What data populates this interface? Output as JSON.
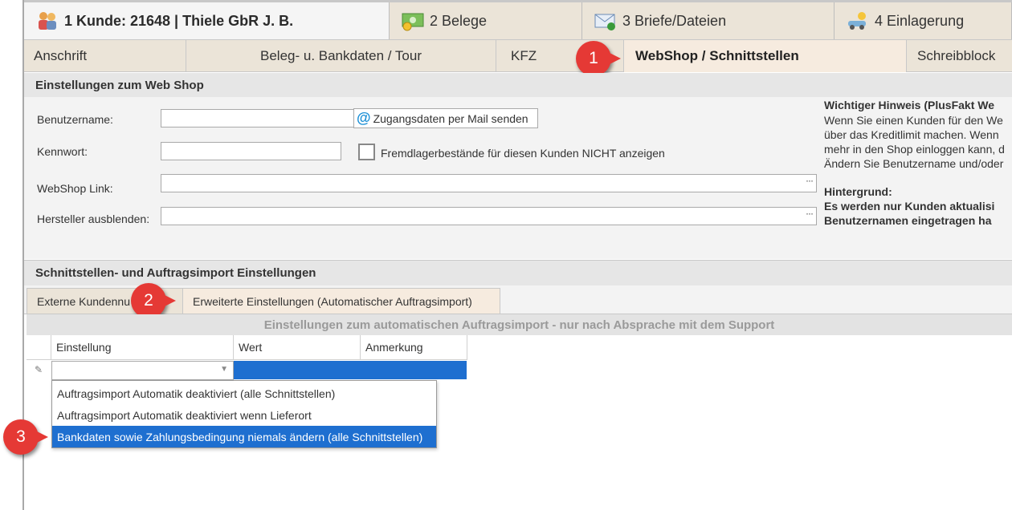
{
  "top_tabs": {
    "customer": "1 Kunde: 21648 | Thiele GbR J. B.",
    "belege": "2 Belege",
    "briefe": "3 Briefe/Dateien",
    "einlagerung": "4 Einlagerung"
  },
  "sub_tabs": {
    "anschrift": "Anschrift",
    "beleg": "Beleg- u. Bankdaten / Tour",
    "kfz": "KFZ",
    "webshop": "WebShop / Schnittstellen",
    "schreibblock": "Schreibblock"
  },
  "badges": [
    "1",
    "2",
    "3"
  ],
  "webshop_section": {
    "title": "Einstellungen zum Web Shop",
    "username_label": "Benutzername:",
    "username_value": "",
    "mail_button": "Zugangsdaten per Mail senden",
    "password_label": "Kennwort:",
    "password_value": "",
    "checkbox_label": "Fremdlagerbestände für diesen Kunden NICHT anzeigen",
    "link_label": "WebShop Link:",
    "link_value": "",
    "manufacturer_label": "Hersteller ausblenden:",
    "manufacturer_value": "",
    "ellipsis": "···"
  },
  "note": {
    "title": "Wichtiger Hinweis (PlusFakt We",
    "lines": [
      "Wenn Sie einen Kunden für den We",
      "über das Kreditlimit machen. Wenn",
      "mehr in den Shop einloggen kann, d",
      "Ändern Sie Benutzername und/oder"
    ],
    "bg_title": "Hintergrund:",
    "bg_lines": [
      "Es werden nur Kunden aktualisi",
      "Benutzernamen eingetragen ha"
    ]
  },
  "interface_section": {
    "title": "Schnittstellen- und Auftragsimport Einstellungen",
    "tabs": [
      "Externe Kundennu",
      "Erweiterte Einstellungen  (Automatischer Auftragsimport)"
    ],
    "grid_caption": "Einstellungen zum automatischen Auftragsimport - nur nach Absprache mit dem Support",
    "columns": [
      "Einstellung",
      "Wert",
      "Anmerkung"
    ],
    "dropdown_options": [
      "Auftragsimport Automatik deaktiviert (alle Schnittstellen)",
      "Auftragsimport Automatik deaktiviert wenn Lieferort",
      "Bankdaten sowie Zahlungsbedingung niemals ändern (alle Schnittstellen)"
    ],
    "selected_index": 2
  },
  "colors": {
    "badge": "#e53935",
    "selection": "#1e6fd0",
    "tab_bg": "#ebe4d8"
  }
}
